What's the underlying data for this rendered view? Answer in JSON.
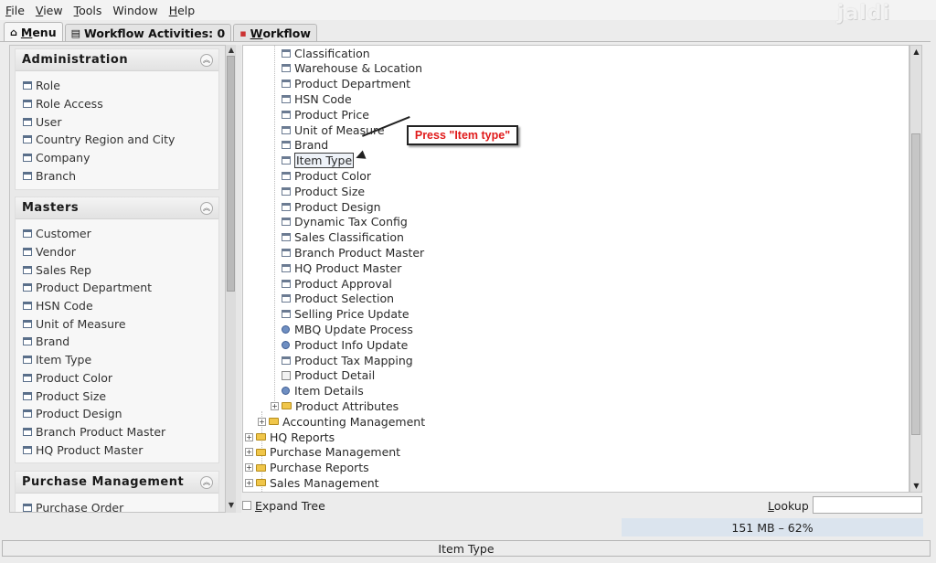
{
  "menubar": {
    "file": "ile",
    "file_key": "F",
    "view": "iew",
    "view_key": "V",
    "tools": "ools",
    "tools_key": "T",
    "window": "Window",
    "help": "elp",
    "help_key": "H"
  },
  "logo": "jaldi",
  "tabs": {
    "menu": "enu",
    "menu_key": "M",
    "workflow_activities": "Workflow Activities: 0",
    "workflow": "orkflow",
    "workflow_key": "W"
  },
  "left_groups": [
    {
      "title": "Administration",
      "items": [
        "Role",
        "Role Access",
        "User",
        "Country Region and City",
        "Company",
        "Branch"
      ]
    },
    {
      "title": "Masters",
      "items": [
        "Customer",
        "Vendor",
        "Sales Rep",
        "Product Department",
        "HSN Code",
        "Unit of Measure",
        "Brand",
        "Item Type",
        "Product Color",
        "Product Size",
        "Product Design",
        "Branch Product Master",
        "HQ Product Master"
      ]
    },
    {
      "title": "Purchase Management",
      "items": [
        "Purchase Order"
      ]
    }
  ],
  "tree": {
    "nodes": [
      {
        "label": "Classification",
        "icon": "window-icon"
      },
      {
        "label": "Warehouse & Location",
        "icon": "window-icon"
      },
      {
        "label": "Product Department",
        "icon": "window-icon"
      },
      {
        "label": "HSN Code",
        "icon": "window-icon"
      },
      {
        "label": "Product Price",
        "icon": "window-icon"
      },
      {
        "label": "Unit of Measure",
        "icon": "window-icon"
      },
      {
        "label": "Brand",
        "icon": "window-icon"
      },
      {
        "label": "Item Type",
        "icon": "window-icon",
        "selected": true
      },
      {
        "label": "Product Color",
        "icon": "window-icon"
      },
      {
        "label": "Product Size",
        "icon": "window-icon"
      },
      {
        "label": "Product Design",
        "icon": "window-icon"
      },
      {
        "label": "Dynamic Tax Config",
        "icon": "window-icon"
      },
      {
        "label": "Sales Classification",
        "icon": "window-icon"
      },
      {
        "label": "Branch Product Master",
        "icon": "window-icon"
      },
      {
        "label": "HQ Product Master",
        "icon": "window-icon"
      },
      {
        "label": "Product Approval",
        "icon": "window-icon"
      },
      {
        "label": "Product Selection",
        "icon": "window-icon"
      },
      {
        "label": "Selling Price Update",
        "icon": "window-icon"
      },
      {
        "label": "MBQ Update Process",
        "icon": "gear-icon"
      },
      {
        "label": "Product Info Update",
        "icon": "gear-icon"
      },
      {
        "label": "Product Tax Mapping",
        "icon": "window-icon"
      },
      {
        "label": "Product Detail",
        "icon": "report-icon"
      },
      {
        "label": "Item Details",
        "icon": "gear-icon"
      },
      {
        "label": "Product Attributes",
        "icon": "folder-icon",
        "expander": true
      },
      {
        "label": "Accounting Management",
        "icon": "folder-icon",
        "expander": true
      },
      {
        "label": "HQ Reports",
        "icon": "folder-icon",
        "expander": true
      },
      {
        "label": "Purchase Management",
        "icon": "folder-icon",
        "expander": true
      },
      {
        "label": "Purchase Reports",
        "icon": "folder-icon",
        "expander": true
      },
      {
        "label": "Sales Management",
        "icon": "folder-icon",
        "expander": true
      }
    ],
    "callout": "Press \"Item type\"",
    "expand_tree": "xpand Tree",
    "expand_tree_key": "E",
    "lookup": "ookup",
    "lookup_key": "L",
    "lookup_value": ""
  },
  "memory": "151 MB – 62%",
  "status": "Item Type"
}
